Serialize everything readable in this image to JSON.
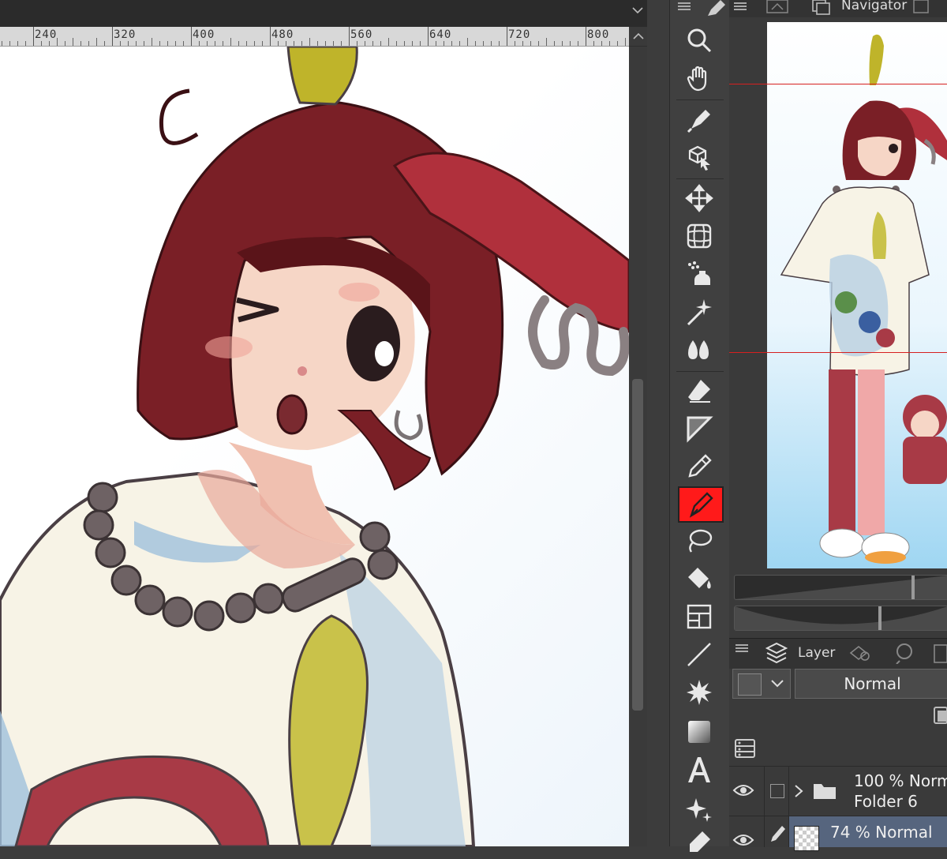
{
  "ruler": {
    "labels": [
      "240",
      "320",
      "400",
      "480",
      "560",
      "640",
      "720",
      "800"
    ]
  },
  "navigator": {
    "title": "Navigator"
  },
  "layer_panel": {
    "tab_label": "Layer",
    "blend_mode": "Normal",
    "layers": [
      {
        "opacity_mode": "100 % Norm",
        "name": "Folder 6",
        "type": "folder"
      },
      {
        "opacity_mode": "74 % Normal",
        "name": "",
        "type": "raster"
      }
    ]
  },
  "toolbar": {
    "active_tool": "pen-tool",
    "accent_color": "#ff1a1a"
  }
}
